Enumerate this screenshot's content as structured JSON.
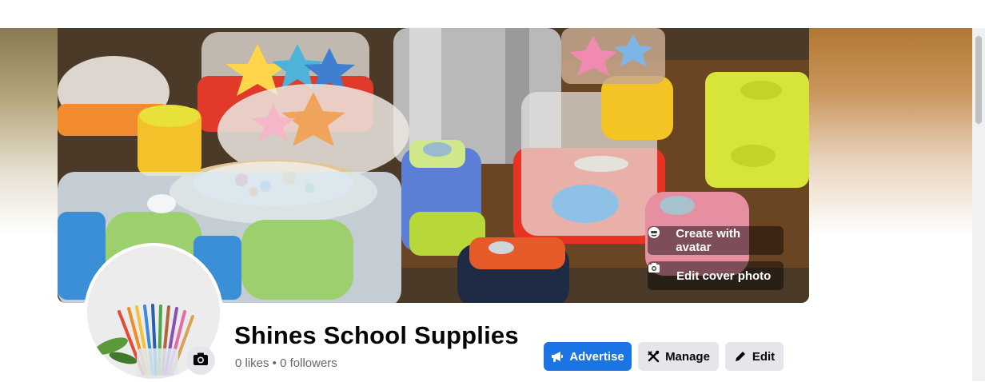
{
  "cover": {
    "create_avatar_label": "Create with avatar",
    "edit_cover_label": "Edit cover photo"
  },
  "profile": {
    "page_name": "Shines School Supplies",
    "stats": "0 likes • 0 followers"
  },
  "actions": {
    "advertise_label": "Advertise",
    "manage_label": "Manage",
    "edit_label": "Edit"
  },
  "colors": {
    "primary": "#1b74e4",
    "secondary_button": "#e4e6eb",
    "muted_text": "#65676b"
  },
  "icons": {
    "create_avatar": "avatar-icon",
    "edit_cover": "camera-icon",
    "advertise": "megaphone-icon",
    "manage": "tools-icon",
    "edit": "pencil-icon",
    "avatar_upload": "camera-icon"
  }
}
